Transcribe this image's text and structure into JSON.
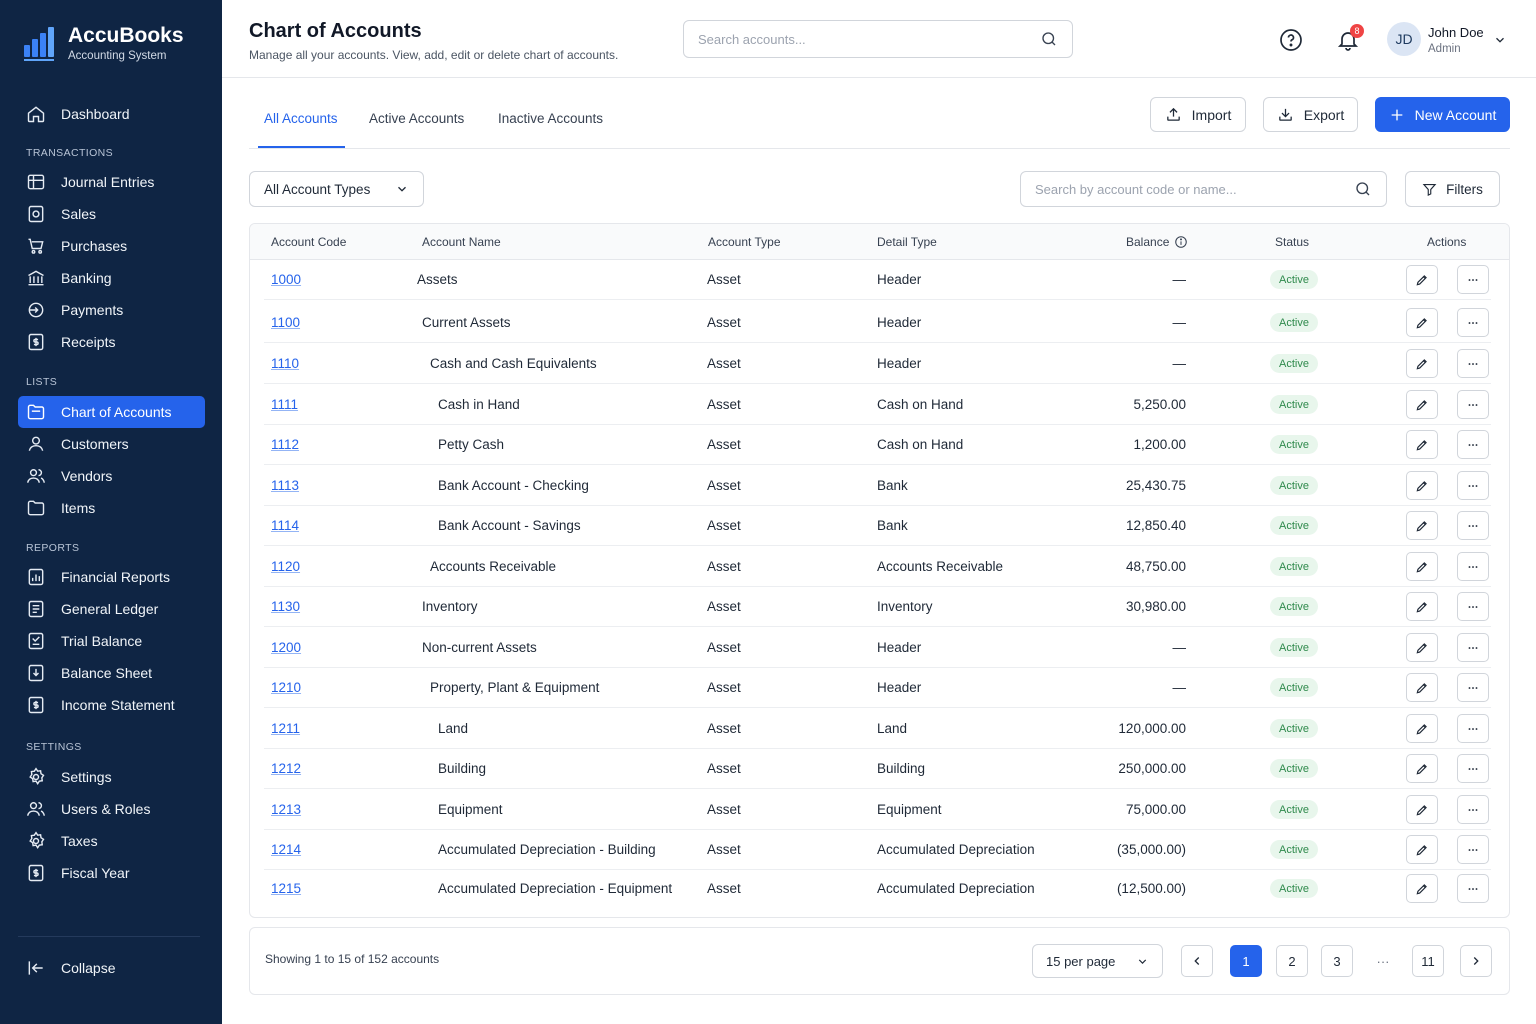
{
  "brand": {
    "name": "AccuBooks",
    "subtitle": "Accounting System"
  },
  "sidebar": {
    "dashboard": "Dashboard",
    "sections": {
      "transactions": "TRANSACTIONS",
      "lists": "LISTS",
      "reports": "REPORTS",
      "settings": "SETTINGS"
    },
    "transactions": [
      "Journal Entries",
      "Sales",
      "Purchases",
      "Banking",
      "Payments",
      "Receipts"
    ],
    "lists": [
      "Chart of Accounts",
      "Customers",
      "Vendors",
      "Items"
    ],
    "reports": [
      "Financial Reports",
      "General Ledger",
      "Trial Balance",
      "Balance Sheet",
      "Income Statement"
    ],
    "settings": [
      "Settings",
      "Users & Roles",
      "Taxes",
      "Fiscal Year"
    ],
    "collapse": "Collapse",
    "active_item": "Chart of Accounts"
  },
  "header": {
    "title": "Chart of Accounts",
    "subtitle": "Manage all your accounts. View, add, edit or delete chart of accounts.",
    "search_placeholder": "Search accounts...",
    "notification_count": "8",
    "user": {
      "initials": "JD",
      "name": "John Doe",
      "role": "Admin"
    }
  },
  "tabs": [
    "All Accounts",
    "Active Accounts",
    "Inactive Accounts"
  ],
  "toolbar": {
    "import": "Import",
    "export": "Export",
    "new_account": "New Account"
  },
  "filters": {
    "account_type": "All Account Types",
    "search_placeholder": "Search by account code or name...",
    "filters_label": "Filters"
  },
  "table": {
    "columns": {
      "code": "Account Code",
      "name": "Account Name",
      "type": "Account Type",
      "detail": "Detail Type",
      "balance": "Balance",
      "status": "Status",
      "actions": "Actions"
    },
    "rows": [
      {
        "code": "1000",
        "name": "Assets",
        "level": 0,
        "type": "Asset",
        "detail": "Header",
        "balance": "—",
        "status": "Active"
      },
      {
        "code": "1100",
        "name": "Current Assets",
        "level": 1,
        "type": "Asset",
        "detail": "Header",
        "balance": "—",
        "status": "Active"
      },
      {
        "code": "1110",
        "name": "Cash and Cash Equivalents",
        "level": 2,
        "type": "Asset",
        "detail": "Header",
        "balance": "—",
        "status": "Active"
      },
      {
        "code": "1111",
        "name": "Cash in Hand",
        "level": 3,
        "type": "Asset",
        "detail": "Cash on Hand",
        "balance": "5,250.00",
        "status": "Active"
      },
      {
        "code": "1112",
        "name": "Petty Cash",
        "level": 3,
        "type": "Asset",
        "detail": "Cash on Hand",
        "balance": "1,200.00",
        "status": "Active"
      },
      {
        "code": "1113",
        "name": "Bank Account - Checking",
        "level": 3,
        "type": "Asset",
        "detail": "Bank",
        "balance": "25,430.75",
        "status": "Active"
      },
      {
        "code": "1114",
        "name": "Bank Account - Savings",
        "level": 3,
        "type": "Asset",
        "detail": "Bank",
        "balance": "12,850.40",
        "status": "Active"
      },
      {
        "code": "1120",
        "name": "Accounts Receivable",
        "level": 2,
        "type": "Asset",
        "detail": "Accounts Receivable",
        "balance": "48,750.00",
        "status": "Active"
      },
      {
        "code": "1130",
        "name": "Inventory",
        "level": 1,
        "type": "Asset",
        "detail": "Inventory",
        "balance": "30,980.00",
        "status": "Active"
      },
      {
        "code": "1200",
        "name": "Non-current Assets",
        "level": 1,
        "type": "Asset",
        "detail": "Header",
        "balance": "—",
        "status": "Active"
      },
      {
        "code": "1210",
        "name": "Property, Plant & Equipment",
        "level": 2,
        "type": "Asset",
        "detail": "Header",
        "balance": "—",
        "status": "Active"
      },
      {
        "code": "1211",
        "name": "Land",
        "level": 3,
        "type": "Asset",
        "detail": "Land",
        "balance": "120,000.00",
        "status": "Active"
      },
      {
        "code": "1212",
        "name": "Building",
        "level": 3,
        "type": "Asset",
        "detail": "Building",
        "balance": "250,000.00",
        "status": "Active"
      },
      {
        "code": "1213",
        "name": "Equipment",
        "level": 3,
        "type": "Asset",
        "detail": "Equipment",
        "balance": "75,000.00",
        "status": "Active"
      },
      {
        "code": "1214",
        "name": "Accumulated Depreciation - Building",
        "level": 3,
        "type": "Asset",
        "detail": "Accumulated Depreciation",
        "balance": "(35,000.00)",
        "status": "Active"
      },
      {
        "code": "1215",
        "name": "Accumulated Depreciation - Equipment",
        "level": 3,
        "type": "Asset",
        "detail": "Accumulated Depreciation",
        "balance": "(12,500.00)",
        "status": "Active"
      }
    ]
  },
  "pagination": {
    "summary": "Showing 1 to 15 of 152 accounts",
    "per_page": "15 per page",
    "pages": [
      "1",
      "2",
      "3",
      "...",
      "11"
    ],
    "current": "1"
  },
  "colors": {
    "sidebar_bg": "#0f2544",
    "accent": "#2563eb",
    "status_active_bg": "#e8f6ec",
    "status_active_text": "#2f8a4c"
  }
}
